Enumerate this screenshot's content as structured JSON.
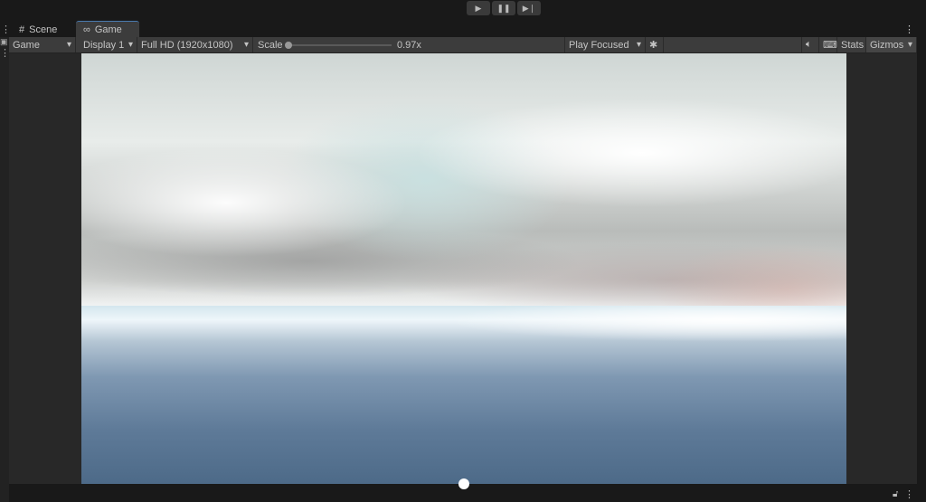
{
  "playbar": {
    "play": "▶",
    "pause": "❚❚",
    "step": "▶❘"
  },
  "tabs": [
    {
      "label": "Scene",
      "icon": "#"
    },
    {
      "label": "Game",
      "icon": "∞"
    }
  ],
  "toolbar": {
    "view_select": "Game",
    "display": "Display 1",
    "resolution": "Full HD (1920x1080)",
    "scale_label": "Scale",
    "scale_value": "0.97x",
    "scale_fraction": 0.0,
    "play_mode": "Play Focused",
    "stats": "Stats",
    "gizmos": "Gizmos"
  }
}
